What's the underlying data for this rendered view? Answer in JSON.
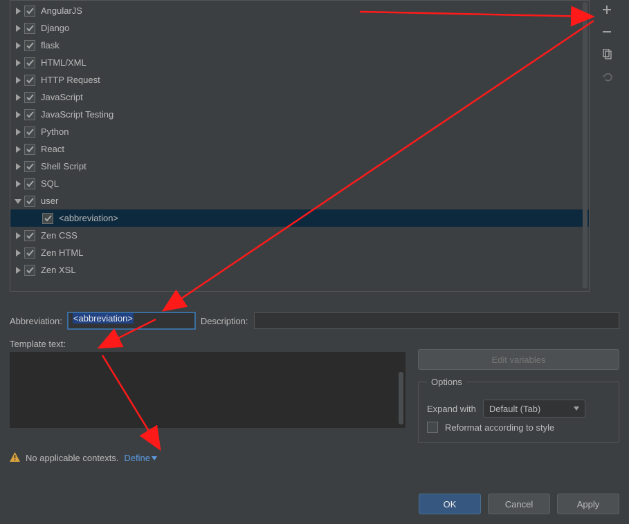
{
  "tree": {
    "items": [
      {
        "label": "AngularJS",
        "checked": true,
        "expanded": false,
        "depth": 0
      },
      {
        "label": "Django",
        "checked": true,
        "expanded": false,
        "depth": 0
      },
      {
        "label": "flask",
        "checked": true,
        "expanded": false,
        "depth": 0
      },
      {
        "label": "HTML/XML",
        "checked": true,
        "expanded": false,
        "depth": 0
      },
      {
        "label": "HTTP Request",
        "checked": true,
        "expanded": false,
        "depth": 0
      },
      {
        "label": "JavaScript",
        "checked": true,
        "expanded": false,
        "depth": 0
      },
      {
        "label": "JavaScript Testing",
        "checked": true,
        "expanded": false,
        "depth": 0
      },
      {
        "label": "Python",
        "checked": true,
        "expanded": false,
        "depth": 0
      },
      {
        "label": "React",
        "checked": true,
        "expanded": false,
        "depth": 0
      },
      {
        "label": "Shell Script",
        "checked": true,
        "expanded": false,
        "depth": 0
      },
      {
        "label": "SQL",
        "checked": true,
        "expanded": false,
        "depth": 0
      },
      {
        "label": "user",
        "checked": true,
        "expanded": true,
        "depth": 0
      },
      {
        "label": "<abbreviation>",
        "checked": true,
        "expanded": null,
        "depth": 1,
        "selected": true
      },
      {
        "label": "Zen CSS",
        "checked": true,
        "expanded": false,
        "depth": 0
      },
      {
        "label": "Zen HTML",
        "checked": true,
        "expanded": false,
        "depth": 0
      },
      {
        "label": "Zen XSL",
        "checked": true,
        "expanded": false,
        "depth": 0
      }
    ]
  },
  "toolbar": {
    "add": "add-icon",
    "remove": "remove-icon",
    "copy": "copy-icon",
    "undo": "undo-icon"
  },
  "form": {
    "abbr_label": "Abbreviation:",
    "abbr_value": "<abbreviation>",
    "desc_label": "Description:",
    "desc_value": "",
    "tmpl_label": "Template text:",
    "edit_vars": "Edit variables",
    "options_title": "Options",
    "expand_label": "Expand with",
    "expand_value": "Default (Tab)",
    "reformat_label": "Reformat according to style"
  },
  "warn": {
    "text": "No applicable contexts.",
    "define": "Define"
  },
  "buttons": {
    "ok": "OK",
    "cancel": "Cancel",
    "apply": "Apply"
  }
}
